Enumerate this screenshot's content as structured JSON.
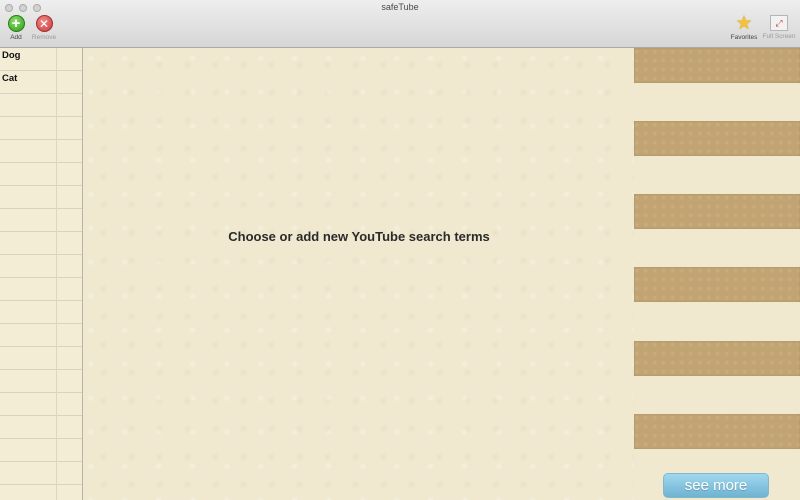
{
  "window": {
    "title": "safeTube"
  },
  "toolbar": {
    "add_label": "Add",
    "remove_label": "Remove",
    "favorites_label": "Favorites",
    "fullscreen_label": "Full Screen"
  },
  "sidebar": {
    "terms": [
      {
        "label": "Dog"
      },
      {
        "label": "Cat"
      }
    ]
  },
  "main": {
    "hint": "Choose or add new YouTube search terms"
  },
  "results": {
    "see_more_label": "see more"
  },
  "colors": {
    "background": "#f0e9d0",
    "thumbnail": "#c1a472",
    "see_more_button": "#82c4e0"
  }
}
